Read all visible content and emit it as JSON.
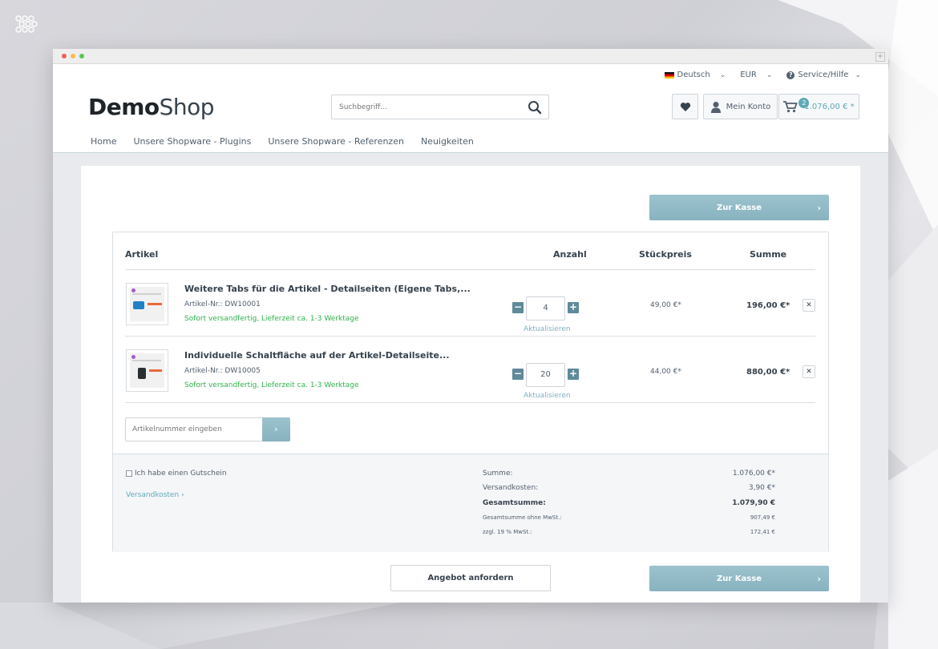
{
  "colors": {
    "accent": "#5fa9b8",
    "primary_button": "#8fb8c5",
    "delivery_green": "#2fb14a",
    "text": "#52606e"
  },
  "window": {
    "controls": [
      "close",
      "minimize",
      "maximize"
    ],
    "new_tab_label": "+"
  },
  "topbar": {
    "language": "Deutsch",
    "currency": "EUR",
    "service": "Service/Hilfe",
    "flag_icon": "germany-flag-icon",
    "help_icon": "question-circle-icon"
  },
  "brand": {
    "part1": "Demo",
    "part2": "Shop"
  },
  "search": {
    "placeholder": "Suchbegriff...",
    "icon": "search-icon"
  },
  "header_buttons": {
    "wishlist_icon": "heart-icon",
    "account_icon": "user-icon",
    "account_label": "Mein Konto",
    "cart_icon": "cart-icon",
    "cart_count": "2",
    "cart_total": "1.076,00 € *"
  },
  "nav": [
    "Home",
    "Unsere Shopware - Plugins",
    "Unsere Shopware - Referenzen",
    "Neuigkeiten"
  ],
  "checkout_button": {
    "label": "Zur Kasse",
    "arrow": "›"
  },
  "table": {
    "headers": {
      "article": "Artikel",
      "quantity": "Anzahl",
      "unit_price": "Stückpreis",
      "total": "Summe"
    },
    "rows": [
      {
        "title": "Weitere Tabs für die Artikel - Detailseiten (Eigene Tabs,...",
        "sku": "Artikel-Nr.: DW10001",
        "delivery": "Sofort versandfertig, Lieferzeit ca. 1-3 Werktage",
        "quantity": "4",
        "update": "Aktualisieren",
        "unit_price": "49,00 €*",
        "total": "196,00 €*"
      },
      {
        "title": "Individuelle Schaltfläche auf der Artikel-Detailseite...",
        "sku": "Artikel-Nr.: DW10005",
        "delivery": "Sofort versandfertig, Lieferzeit ca. 1-3 Werktage",
        "quantity": "20",
        "update": "Aktualisieren",
        "unit_price": "44,00 €*",
        "total": "880,00 €*"
      }
    ],
    "minus": "−",
    "plus": "+",
    "remove": "✕"
  },
  "sku_add": {
    "placeholder": "Artikelnummer eingeben",
    "button": "›"
  },
  "footer": {
    "voucher_label": "Ich habe einen Gutschein",
    "shipping_link": "Versandkosten ›",
    "aggregation": [
      {
        "label": "Summe:",
        "value": "1.076,00 €*"
      },
      {
        "label": "Versandkosten:",
        "value": "3,90 €*"
      },
      {
        "label": "Gesamtsumme:",
        "value": "1.079,90 €"
      },
      {
        "label": "Gesamtsumme ohne MwSt.:",
        "value": "907,49 €"
      },
      {
        "label": "zzgl. 19 % MwSt.:",
        "value": "172,41 €"
      }
    ]
  },
  "offer_button": {
    "label": "Angebot anfordern"
  }
}
